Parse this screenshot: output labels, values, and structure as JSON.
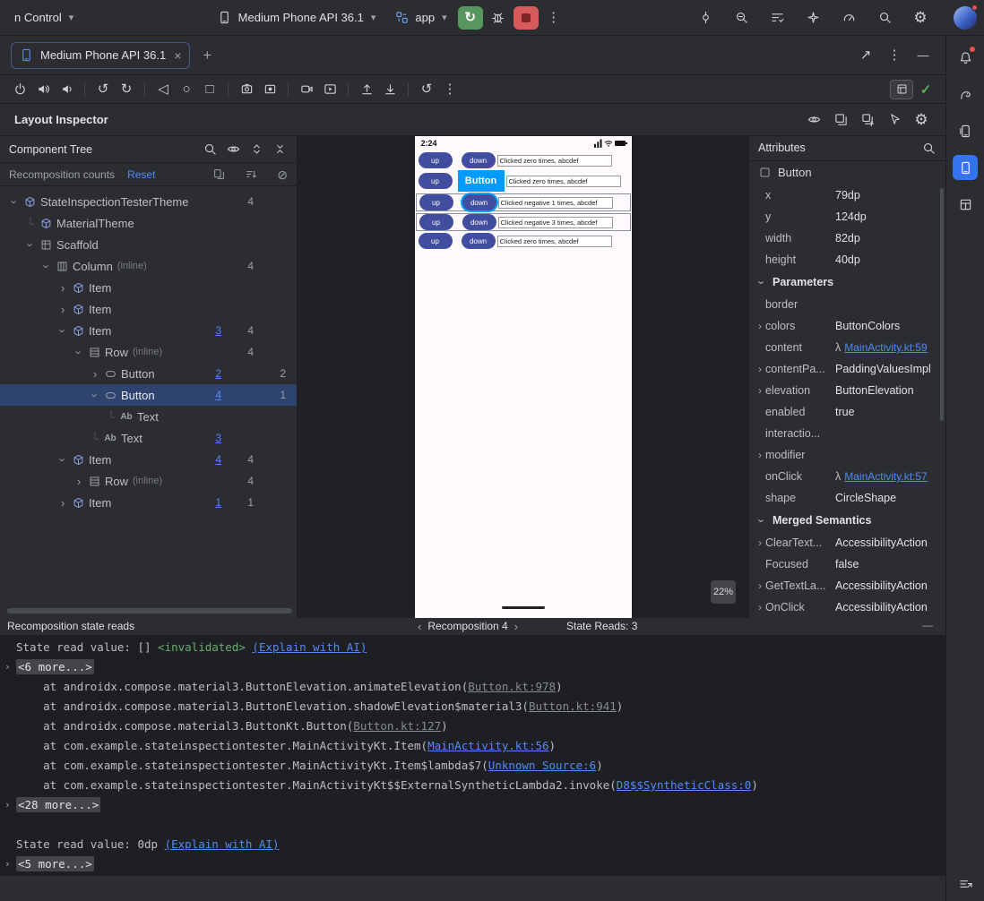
{
  "icons": {
    "chevron_down": "▾",
    "more_vertical": "⋮",
    "back": "◁",
    "home": "○",
    "overview": "□",
    "rotate_left": "↺",
    "rotate_right": "↻",
    "restore": "↺",
    "close": "×",
    "plus": "+",
    "external": "↗",
    "minimize": "—",
    "check": "✓",
    "block": "⊘",
    "gear": "⚙",
    "prev": "‹",
    "next": "›",
    "rerun": "↻",
    "lambda": "λ"
  },
  "top_bar": {
    "project_menu": "n Control",
    "device_selector": "Medium Phone API 36.1",
    "run_config": "app"
  },
  "tab_bar": {
    "active_tab": "Medium Phone API 36.1"
  },
  "inspector": {
    "title": "Layout Inspector"
  },
  "component_tree": {
    "title": "Component Tree",
    "recomposition_label": "Recomposition counts",
    "reset_label": "Reset",
    "rows": [
      {
        "depth": 0,
        "exp": "open",
        "icon": "cube",
        "label": "StateInspectionTesterTheme",
        "count": "4"
      },
      {
        "depth": 1,
        "exp": "none",
        "icon": "cube",
        "label": "MaterialTheme"
      },
      {
        "depth": 1,
        "exp": "open",
        "icon": "grid",
        "label": "Scaffold"
      },
      {
        "depth": 2,
        "exp": "open",
        "icon": "columnic",
        "label": "Column",
        "suffix": "(inline)",
        "count": "4"
      },
      {
        "depth": 3,
        "exp": "closed",
        "icon": "cube",
        "label": "Item"
      },
      {
        "depth": 3,
        "exp": "closed",
        "icon": "cube",
        "label": "Item"
      },
      {
        "depth": 3,
        "exp": "open",
        "icon": "cube",
        "label": "Item",
        "link_count": "3",
        "count": "4"
      },
      {
        "depth": 4,
        "exp": "open",
        "icon": "rowic",
        "label": "Row",
        "suffix": "(inline)",
        "count": "4"
      },
      {
        "depth": 5,
        "exp": "closed",
        "icon": "buttonic",
        "label": "Button",
        "link_count": "2",
        "skipped": "2"
      },
      {
        "depth": 5,
        "exp": "open",
        "icon": "buttonic",
        "label": "Button",
        "link_count": "4",
        "skipped": "1",
        "selected": true
      },
      {
        "depth": 6,
        "exp": "none",
        "icon": "text",
        "label": "Text"
      },
      {
        "depth": 5,
        "exp": "none",
        "icon": "text",
        "label": "Text",
        "link_count": "3"
      },
      {
        "depth": 3,
        "exp": "open",
        "icon": "cube",
        "label": "Item",
        "link_count": "4",
        "count": "4"
      },
      {
        "depth": 4,
        "exp": "closed",
        "icon": "rowic",
        "label": "Row",
        "suffix": "(inline)",
        "count": "4"
      },
      {
        "depth": 3,
        "exp": "closed",
        "icon": "cube",
        "label": "Item",
        "link_count": "1",
        "count": "1"
      }
    ]
  },
  "device": {
    "time": "2:24",
    "zoom_level": "22%",
    "rows": [
      {
        "up": "up",
        "down": "down",
        "text": "Clicked zero times, abcdef",
        "variant": "plain"
      },
      {
        "up": "up",
        "label": "Button",
        "text": "Clicked zero times, abcdef",
        "variant": "label"
      },
      {
        "up": "up",
        "down": "down",
        "text": "Clicked negative 1 times, abcdef",
        "variant": "selected",
        "twoline": true
      },
      {
        "up": "up",
        "down": "down",
        "text": "Clicked negative 3 times, abcdef",
        "variant": "bordered",
        "twoline": true
      },
      {
        "up": "up",
        "down": "down",
        "text": "Clicked zero times, abcdef",
        "variant": "plain"
      }
    ]
  },
  "attributes": {
    "title": "Attributes",
    "component": "Button",
    "rows": [
      {
        "k": "x",
        "v": "79dp"
      },
      {
        "k": "y",
        "v": "124dp"
      },
      {
        "k": "width",
        "v": "82dp"
      },
      {
        "k": "height",
        "v": "40dp"
      },
      {
        "section": "Parameters"
      },
      {
        "k": "border",
        "v": ""
      },
      {
        "k": "colors",
        "v": "ButtonColors",
        "e": true
      },
      {
        "k": "content",
        "lambda": true,
        "link": "MainActivity.kt:59"
      },
      {
        "k": "contentPa...",
        "v": "PaddingValuesImpl",
        "e": true
      },
      {
        "k": "elevation",
        "v": "ButtonElevation",
        "e": true
      },
      {
        "k": "enabled",
        "v": "true"
      },
      {
        "k": "interactio...",
        "v": ""
      },
      {
        "k": "modifier",
        "v": "",
        "e": true
      },
      {
        "k": "onClick",
        "lambda": true,
        "link": "MainActivity.kt:57"
      },
      {
        "k": "shape",
        "v": "CircleShape"
      },
      {
        "section": "Merged Semantics"
      },
      {
        "k": "ClearText...",
        "v": "AccessibilityAction",
        "e": true
      },
      {
        "k": "Focused",
        "v": "false"
      },
      {
        "k": "GetTextLa...",
        "v": "AccessibilityAction",
        "e": true
      },
      {
        "k": "OnClick",
        "v": "AccessibilityAction",
        "e": true
      }
    ]
  },
  "console": {
    "title": "Recomposition state reads",
    "nav_label": "Recomposition 4",
    "reads_label": "State Reads: 3",
    "lines": [
      {
        "seg": [
          [
            "State read value: [] ",
            "p"
          ],
          [
            "<invalidated>",
            "g"
          ],
          [
            " ",
            "p"
          ],
          [
            "(Explain with AI)",
            "l"
          ]
        ]
      },
      {
        "exp": true,
        "seg": [
          [
            "<6 more...>",
            "c"
          ]
        ]
      },
      {
        "seg": [
          [
            "    at androidx.compose.material3.ButtonElevation.animateElevation(",
            "p"
          ],
          [
            "Button.kt:978",
            "gl"
          ],
          [
            ")",
            "p"
          ]
        ]
      },
      {
        "seg": [
          [
            "    at androidx.compose.material3.ButtonElevation.shadowElevation$material3(",
            "p"
          ],
          [
            "Button.kt:941",
            "gl"
          ],
          [
            ")",
            "p"
          ]
        ]
      },
      {
        "seg": [
          [
            "    at androidx.compose.material3.ButtonKt.Button(",
            "p"
          ],
          [
            "Button.kt:127",
            "gl"
          ],
          [
            ")",
            "p"
          ]
        ]
      },
      {
        "seg": [
          [
            "    at com.example.stateinspectiontester.MainActivityKt.Item(",
            "p"
          ],
          [
            "MainActivity.kt:56",
            "l"
          ],
          [
            ")",
            "p"
          ]
        ]
      },
      {
        "seg": [
          [
            "    at com.example.stateinspectiontester.MainActivityKt.Item$lambda$7(",
            "p"
          ],
          [
            "Unknown Source:6",
            "l"
          ],
          [
            ")",
            "p"
          ]
        ]
      },
      {
        "seg": [
          [
            "    at com.example.stateinspectiontester.MainActivityKt$$ExternalSyntheticLambda2.invoke(",
            "p"
          ],
          [
            "D8$$SyntheticClass:0",
            "l"
          ],
          [
            ")",
            "p"
          ]
        ]
      },
      {
        "exp": true,
        "seg": [
          [
            "<28 more...>",
            "c"
          ]
        ]
      },
      {
        "seg": []
      },
      {
        "seg": [
          [
            "State read value: 0dp ",
            "p"
          ],
          [
            "(Explain with AI)",
            "l"
          ]
        ]
      },
      {
        "exp": true,
        "seg": [
          [
            "<5 more...>",
            "c"
          ]
        ]
      }
    ]
  }
}
